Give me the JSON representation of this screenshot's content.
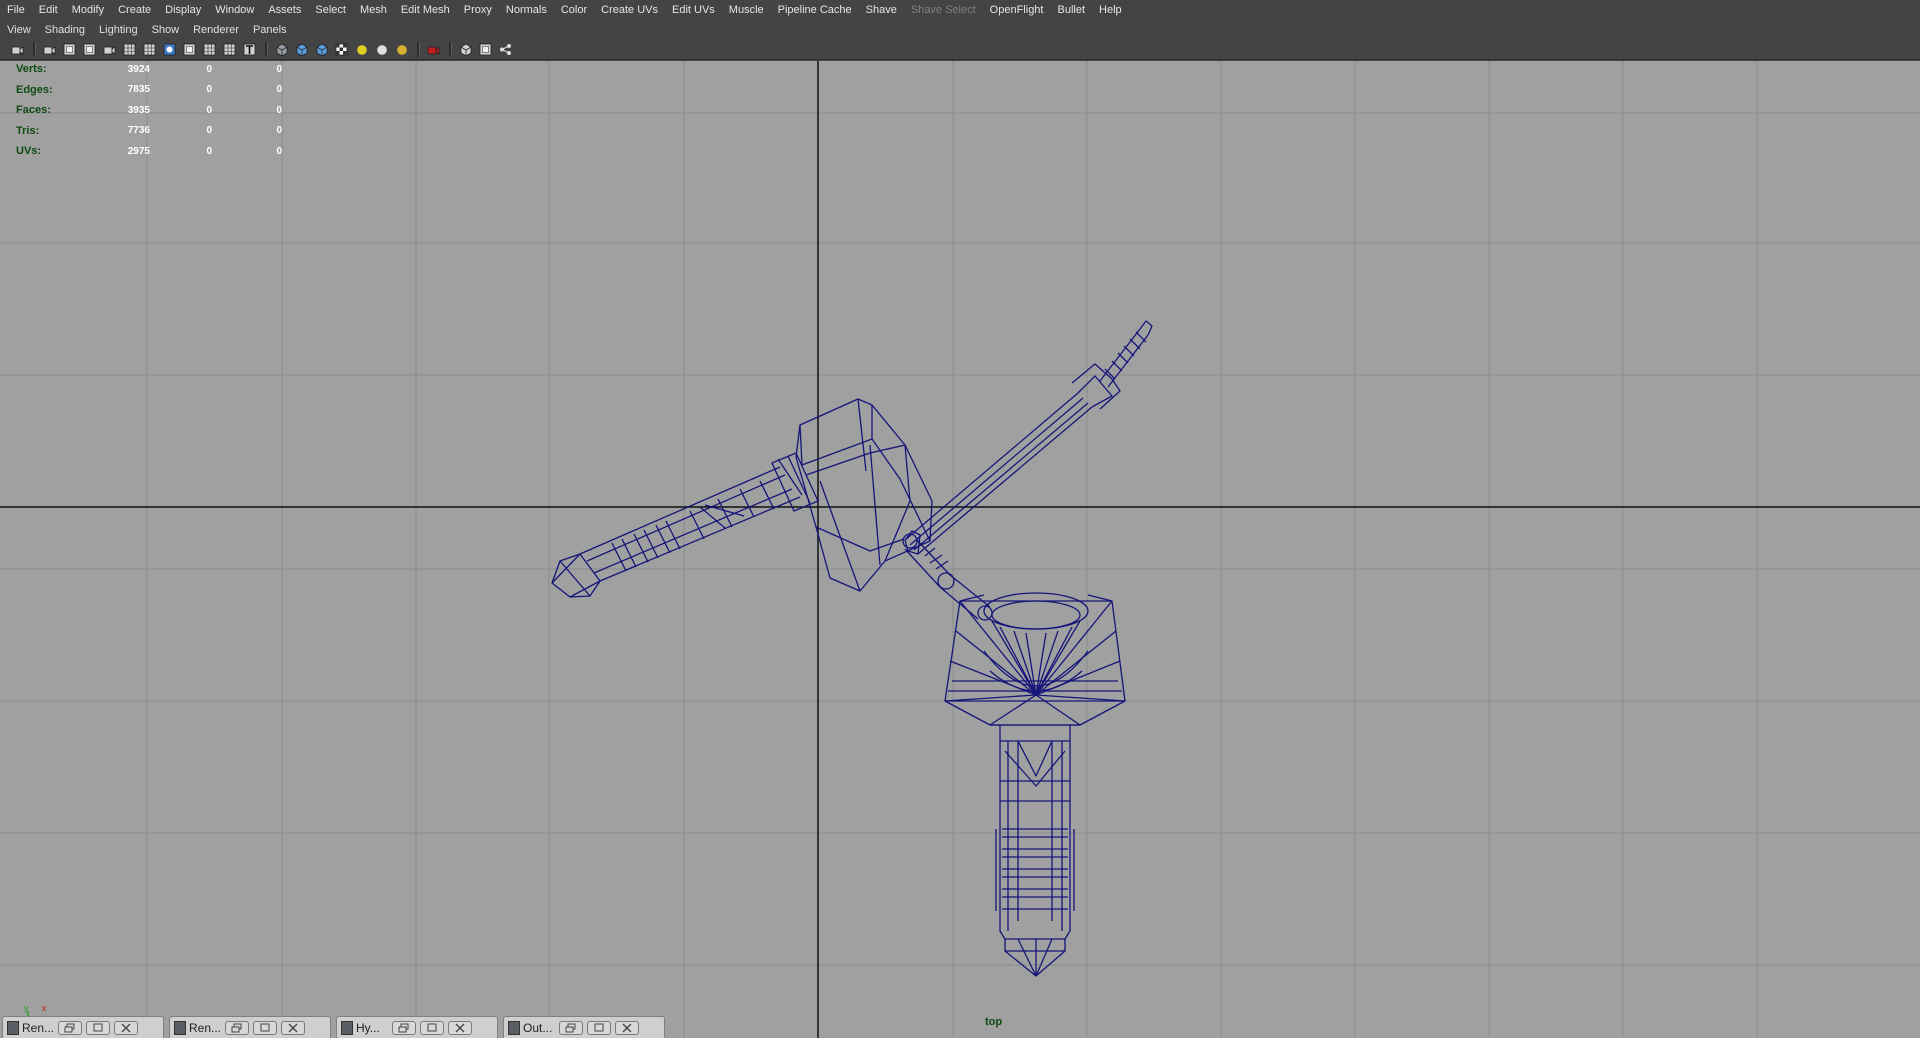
{
  "main_menu": {
    "items": [
      "File",
      "Edit",
      "Modify",
      "Create",
      "Display",
      "Window",
      "Assets",
      "Select",
      "Mesh",
      "Edit Mesh",
      "Proxy",
      "Normals",
      "Color",
      "Create UVs",
      "Edit UVs",
      "Muscle",
      "Pipeline Cache",
      "Shave",
      "Shave Select",
      "OpenFlight",
      "Bullet",
      "Help"
    ],
    "disabled": [
      "Shave Select"
    ]
  },
  "panel_menu": {
    "items": [
      "View",
      "Shading",
      "Lighting",
      "Show",
      "Renderer",
      "Panels"
    ]
  },
  "toolbar": {
    "icons": [
      "camera-select-icon",
      "camera-attributes-icon",
      "bookmark-icon",
      "image-plane-icon",
      "isolate-icon",
      "grid-icon",
      "film-gate-icon",
      "resolution-gate-icon",
      "gate-mask-icon",
      "field-chart-icon",
      "safe-action-icon",
      "safe-title-icon",
      "wireframe-icon",
      "smooth-shade-icon",
      "shade-all-icon",
      "textured-icon",
      "use-default-light-icon",
      "all-lights-icon",
      "shadows-icon",
      "xray-icon",
      "isolate-select-icon",
      "xray-joints-icon",
      "ambient-occlusion-icon"
    ]
  },
  "hud": {
    "rows": [
      {
        "label": "Verts:",
        "v1": "3924",
        "v2": "0",
        "v3": "0"
      },
      {
        "label": "Edges:",
        "v1": "7835",
        "v2": "0",
        "v3": "0"
      },
      {
        "label": "Faces:",
        "v1": "3935",
        "v2": "0",
        "v3": "0"
      },
      {
        "label": "Tris:",
        "v1": "7736",
        "v2": "0",
        "v3": "0"
      },
      {
        "label": "UVs:",
        "v1": "2975",
        "v2": "0",
        "v3": "0"
      }
    ]
  },
  "viewport": {
    "camera": "top",
    "axis": {
      "y": "y",
      "x": "x"
    },
    "background_color": "#a0a0a0",
    "grid_color": "#8c8c8c",
    "axis_line_color": "#111111",
    "wireframe_color": "#15157a"
  },
  "minimized_windows": [
    {
      "title": "Ren..."
    },
    {
      "title": "Ren..."
    },
    {
      "title": "Hy..."
    },
    {
      "title": "Out..."
    }
  ]
}
